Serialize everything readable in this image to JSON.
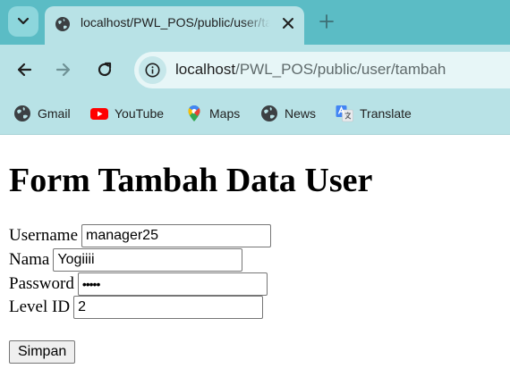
{
  "browser": {
    "tab_title": "localhost/PWL_POS/public/user/tambah",
    "url_host": "localhost",
    "url_path": "/PWL_POS/public/user/tambah",
    "theme_color": "#5bbcc5"
  },
  "bookmarks": [
    {
      "label": "Gmail",
      "icon": "globe-icon"
    },
    {
      "label": "YouTube",
      "icon": "youtube-icon"
    },
    {
      "label": "Maps",
      "icon": "maps-pin-icon"
    },
    {
      "label": "News",
      "icon": "globe-icon"
    },
    {
      "label": "Translate",
      "icon": "translate-icon"
    }
  ],
  "page": {
    "heading": "Form Tambah Data User",
    "fields": {
      "username": {
        "label": "Username",
        "value": "manager25"
      },
      "nama": {
        "label": "Nama",
        "value": "Yogiiii"
      },
      "password": {
        "label": "Password",
        "value": "•••••"
      },
      "level_id": {
        "label": "Level ID",
        "value": "2"
      }
    },
    "submit_label": "Simpan"
  }
}
